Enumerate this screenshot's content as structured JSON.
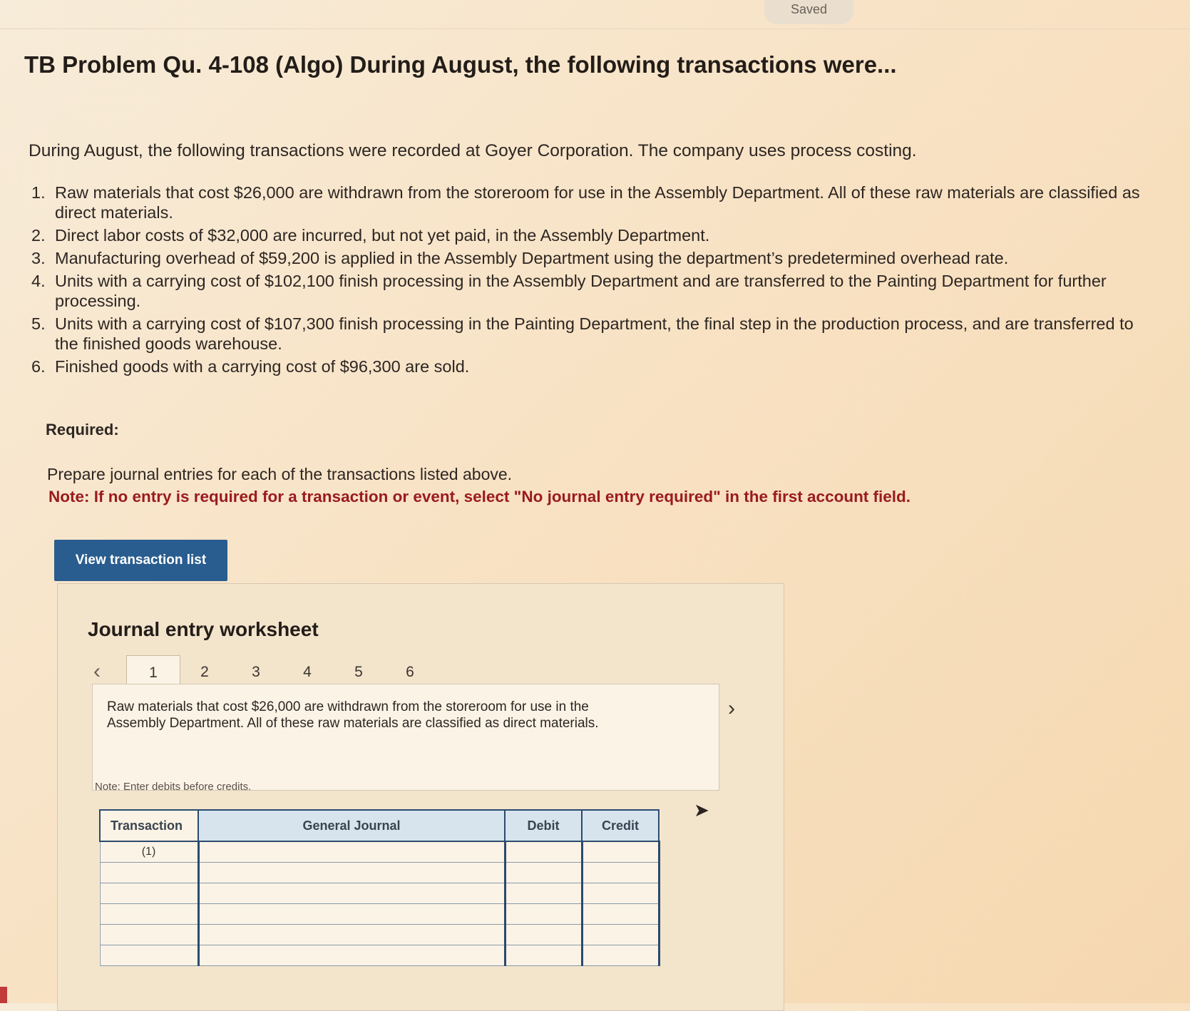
{
  "status": {
    "saved_label": "Saved"
  },
  "problem": {
    "title": "TB Problem Qu. 4-108 (Algo) During August, the following transactions were...",
    "intro": "During August, the following transactions were recorded at Goyer Corporation. The company uses process costing.",
    "transactions": [
      {
        "num": "1.",
        "text": "Raw materials that cost $26,000 are withdrawn from the storeroom for use in the Assembly Department. All of these raw materials are classified as direct materials."
      },
      {
        "num": "2.",
        "text": "Direct labor costs of $32,000 are incurred, but not yet paid, in the Assembly Department."
      },
      {
        "num": "3.",
        "text": "Manufacturing overhead of $59,200 is applied in the Assembly Department using the department’s predetermined overhead rate."
      },
      {
        "num": "4.",
        "text": "Units with a carrying cost of $102,100 finish processing in the Assembly Department and are transferred to the Painting Department for further processing."
      },
      {
        "num": "5.",
        "text": "Units with a carrying cost of $107,300 finish processing in the Painting Department, the final step in the production process, and are transferred to the finished goods warehouse."
      },
      {
        "num": "6.",
        "text": "Finished goods with a carrying cost of $96,300 are sold."
      }
    ],
    "required_label": "Required:",
    "prepare_text": "Prepare journal entries for each of the transactions listed above.",
    "note_text": "Note: If no entry is required for a transaction or event, select \"No journal entry required\" in the first account field."
  },
  "view_button_label": "View transaction list",
  "worksheet": {
    "title": "Journal entry worksheet",
    "tabs": [
      "1",
      "2",
      "3",
      "4",
      "5",
      "6"
    ],
    "active_tab": "1",
    "description": "Raw materials that cost $26,000 are withdrawn from the storeroom for use in the Assembly Department. All of these raw materials are classified as direct materials.",
    "note": "Note: Enter debits before credits.",
    "table": {
      "headers": {
        "transaction": "Transaction",
        "general_journal": "General Journal",
        "debit": "Debit",
        "credit": "Credit"
      },
      "rows": [
        {
          "transaction": "(1)",
          "account": "",
          "debit": "",
          "credit": ""
        },
        {
          "transaction": "",
          "account": "",
          "debit": "",
          "credit": ""
        },
        {
          "transaction": "",
          "account": "",
          "debit": "",
          "credit": ""
        },
        {
          "transaction": "",
          "account": "",
          "debit": "",
          "credit": ""
        },
        {
          "transaction": "",
          "account": "",
          "debit": "",
          "credit": ""
        },
        {
          "transaction": "",
          "account": "",
          "debit": "",
          "credit": ""
        }
      ]
    }
  },
  "icons": {
    "prev": "chevron-left-icon",
    "next": "chevron-right-icon",
    "cursor": "mouse-cursor-icon"
  }
}
